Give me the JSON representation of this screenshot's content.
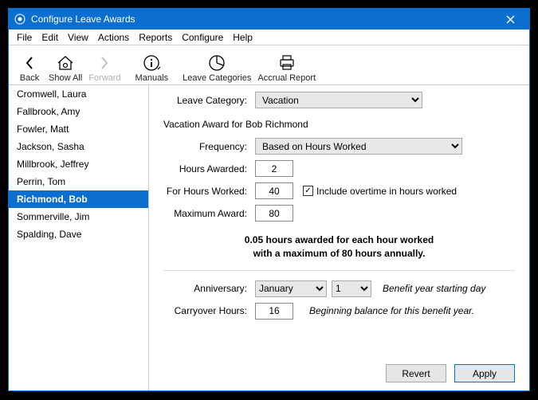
{
  "window": {
    "title": "Configure Leave Awards"
  },
  "menu": {
    "file": "File",
    "edit": "Edit",
    "view": "View",
    "actions": "Actions",
    "reports": "Reports",
    "configure": "Configure",
    "help": "Help"
  },
  "toolbar": {
    "back": "Back",
    "showall": "Show All",
    "forward": "Forward",
    "manuals": "Manuals",
    "leavecat": "Leave Categories",
    "accrual": "Accrual Report"
  },
  "sidebar": {
    "items": [
      {
        "label": "Cromwell, Laura"
      },
      {
        "label": "Fallbrook, Amy"
      },
      {
        "label": "Fowler, Matt"
      },
      {
        "label": "Jackson, Sasha"
      },
      {
        "label": "Millbrook, Jeffrey"
      },
      {
        "label": "Perrin, Tom"
      },
      {
        "label": "Richmond, Bob",
        "selected": true
      },
      {
        "label": "Sommerville, Jim"
      },
      {
        "label": "Spalding, Dave"
      }
    ]
  },
  "form": {
    "leaveCategoryLabel": "Leave Category:",
    "leaveCategory": "Vacation",
    "sectionTitle": "Vacation Award for Bob Richmond",
    "frequencyLabel": "Frequency:",
    "frequency": "Based on Hours Worked",
    "hoursAwardedLabel": "Hours Awarded:",
    "hoursAwarded": "2",
    "forHoursWorkedLabel": "For Hours Worked:",
    "forHoursWorked": "40",
    "includeOvertimeLabel": "Include overtime in hours worked",
    "includeOvertimeChecked": true,
    "maxAwardLabel": "Maximum Award:",
    "maxAward": "80",
    "summaryLine1": "0.05 hours awarded for each hour worked",
    "summaryLine2": "with a maximum of 80 hours annually.",
    "anniversaryLabel": "Anniversary:",
    "anniversaryMonth": "January",
    "anniversaryDay": "1",
    "anniversaryHint": "Benefit year starting day",
    "carryoverLabel": "Carryover Hours:",
    "carryover": "16",
    "carryoverHint": "Beginning balance for this benefit year."
  },
  "buttons": {
    "revert": "Revert",
    "apply": "Apply"
  }
}
